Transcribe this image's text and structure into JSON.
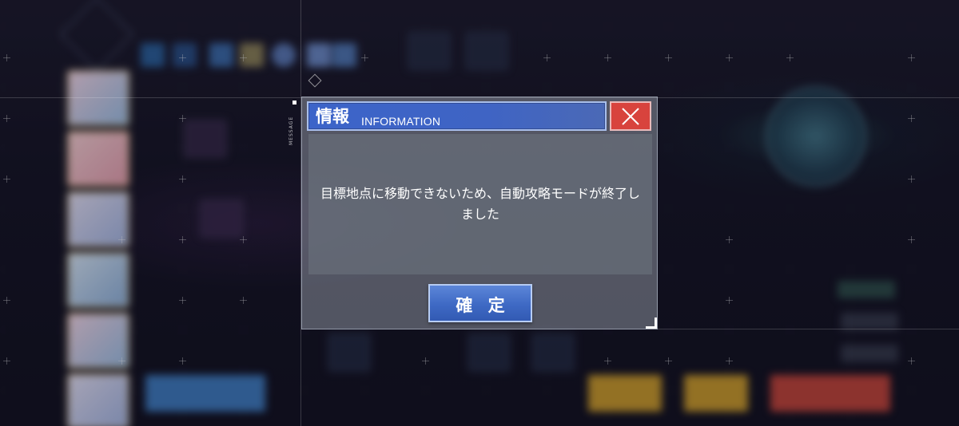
{
  "dialog": {
    "title": "情報",
    "subtitle": "INFORMATION",
    "message": "目標地点に移動できないため、自動攻略モードが終了しました",
    "confirm_label": "確 定",
    "side_tag": "MESSAGE"
  },
  "colors": {
    "header_blue": "#3f64c4",
    "close_red": "#d8433d",
    "confirm_blue": "#3e69c4"
  },
  "icons": {
    "close": "close-icon",
    "back": "back-arrow-icon",
    "radar": "radar-minimap"
  }
}
